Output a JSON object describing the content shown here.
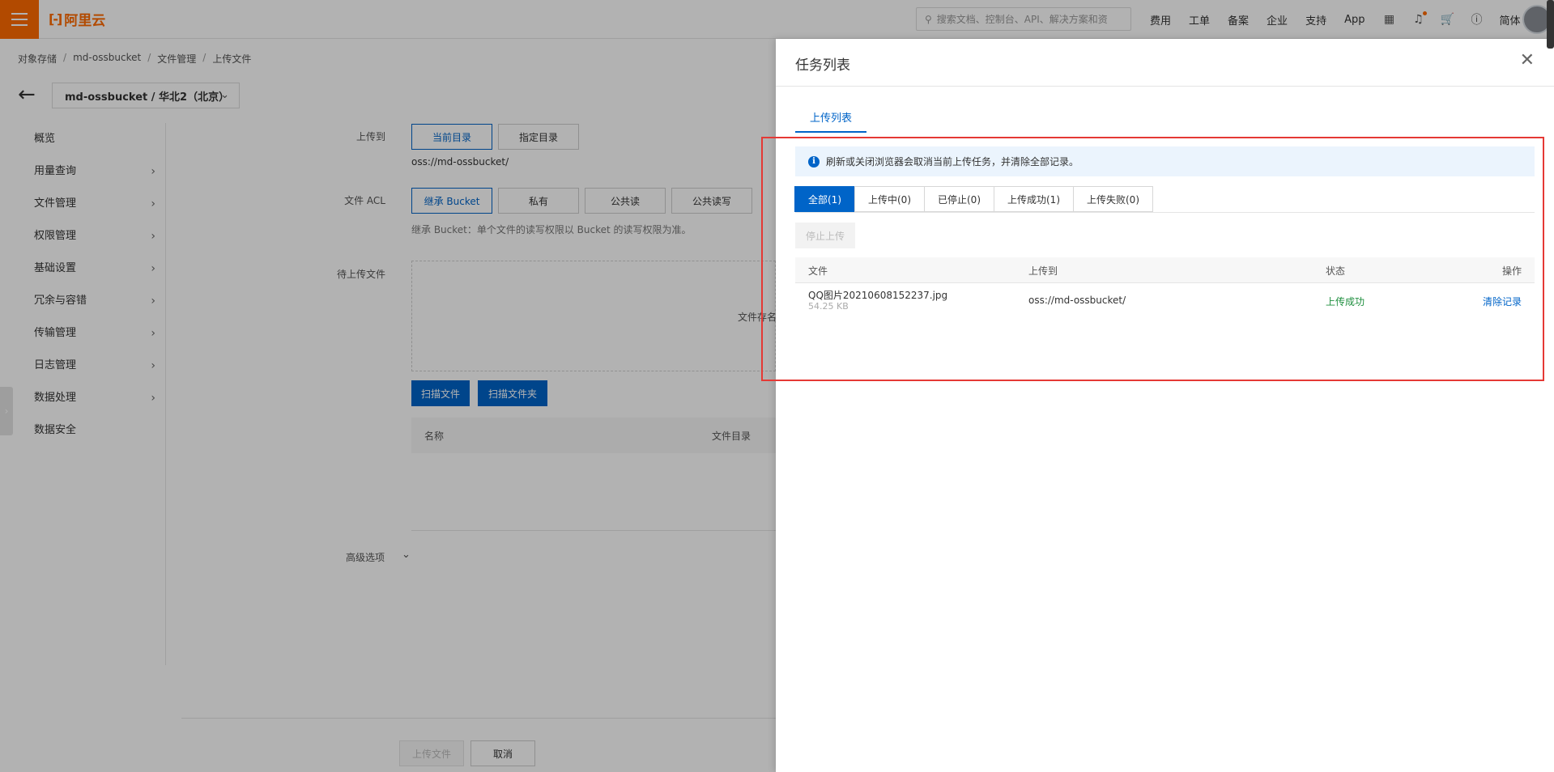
{
  "brand": {
    "name": "阿里云",
    "mark": "[-]",
    "accent": "#ff6a00",
    "primary": "#0064c8"
  },
  "header": {
    "search_placeholder": "搜索文档、控制台、API、解决方案和资",
    "nav": [
      "费用",
      "工单",
      "备案",
      "企业",
      "支持",
      "App"
    ],
    "lang": "简体",
    "icons": [
      "terminal-icon",
      "bell-icon",
      "cart-icon",
      "help-icon"
    ]
  },
  "breadcrumb": [
    "对象存储",
    "md-ossbucket",
    "文件管理",
    "上传文件"
  ],
  "bucket_selector": {
    "value": "md-ossbucket / 华北2（北京）"
  },
  "sidebar": {
    "items": [
      {
        "label": "概览",
        "has_arrow": false
      },
      {
        "label": "用量查询",
        "has_arrow": true
      },
      {
        "label": "文件管理",
        "has_arrow": true
      },
      {
        "label": "权限管理",
        "has_arrow": true
      },
      {
        "label": "基础设置",
        "has_arrow": true
      },
      {
        "label": "冗余与容错",
        "has_arrow": true
      },
      {
        "label": "传输管理",
        "has_arrow": true
      },
      {
        "label": "日志管理",
        "has_arrow": true
      },
      {
        "label": "数据处理",
        "has_arrow": true
      },
      {
        "label": "数据安全",
        "has_arrow": false
      }
    ]
  },
  "form": {
    "upload_to_label": "上传到",
    "upload_to_options": [
      "当前目录",
      "指定目录"
    ],
    "upload_path": "oss://md-ossbucket/",
    "acl_label": "文件 ACL",
    "acl_options": [
      "继承 Bucket",
      "私有",
      "公共读",
      "公共读写"
    ],
    "acl_hint": "继承 Bucket：单个文件的读写权限以 Bucket 的读写权限为准。",
    "pending_label": "待上传文件",
    "drop_text": "文件存名",
    "scan_file": "扫描文件",
    "scan_folder": "扫描文件夹",
    "list_cols": [
      "名称",
      "文件目录"
    ],
    "advanced_label": "高级选项",
    "submit": "上传文件",
    "cancel": "取消"
  },
  "drawer": {
    "title": "任务列表",
    "tab": "上传列表",
    "notice": "刷新或关闭浏览器会取消当前上传任务，并清除全部记录。",
    "filters": [
      "全部(1)",
      "上传中(0)",
      "已停止(0)",
      "上传成功(1)",
      "上传失败(0)"
    ],
    "stop_button": "停止上传",
    "columns": [
      "文件",
      "上传到",
      "状态",
      "操作"
    ],
    "rows": [
      {
        "file": "QQ图片20210608152237.jpg",
        "size": "54.25 KB",
        "dest": "oss://md-ossbucket/",
        "status": "上传成功",
        "action": "清除记录"
      }
    ]
  }
}
